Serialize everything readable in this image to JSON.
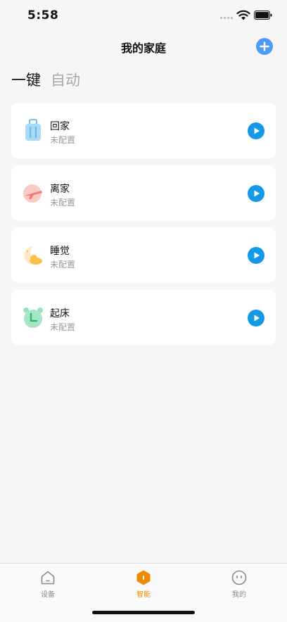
{
  "status_bar": {
    "time": "5:58"
  },
  "header": {
    "title": "我的家庭"
  },
  "tabs": [
    {
      "label": "一键",
      "active": true
    },
    {
      "label": "自动",
      "active": false
    }
  ],
  "scenes": [
    {
      "name": "回家",
      "status": "未配置",
      "icon": "luggage-icon"
    },
    {
      "name": "离家",
      "status": "未配置",
      "icon": "airplane-icon"
    },
    {
      "name": "睡觉",
      "status": "未配置",
      "icon": "moon-cloud-icon"
    },
    {
      "name": "起床",
      "status": "未配置",
      "icon": "alarm-clock-icon"
    }
  ],
  "tab_bar": {
    "items": [
      {
        "label": "设备",
        "icon": "house-icon",
        "active": false
      },
      {
        "label": "智能",
        "icon": "hexagon-smart-icon",
        "active": true
      },
      {
        "label": "我的",
        "icon": "face-icon",
        "active": false
      }
    ]
  },
  "colors": {
    "accent": "#1499e8",
    "add_button": "#4c9bf5",
    "active_tab": "#f08a00",
    "background": "#f6f6f6"
  }
}
